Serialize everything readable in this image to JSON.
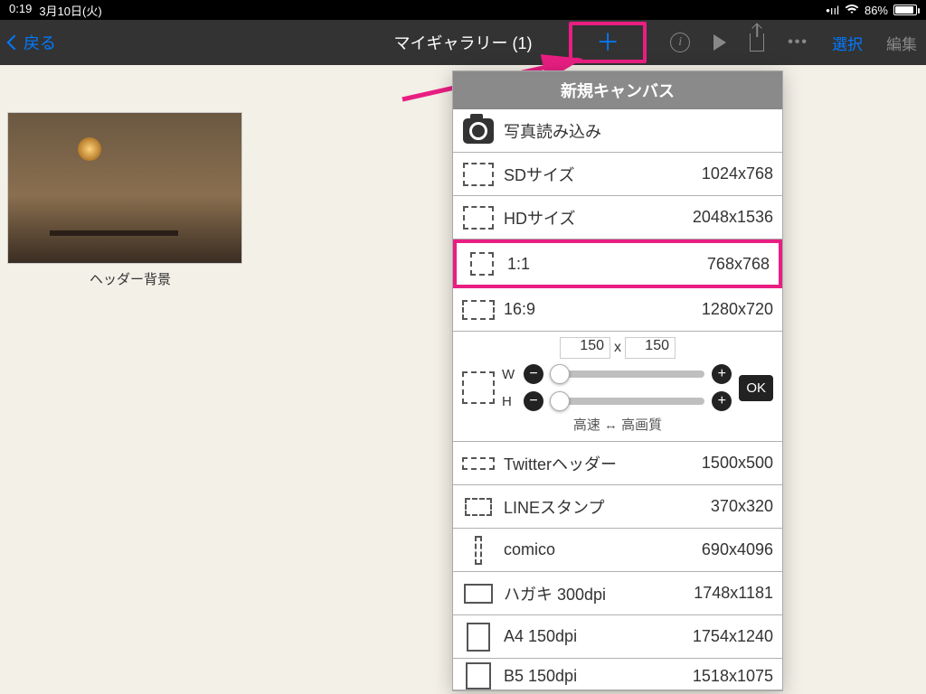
{
  "status": {
    "time": "0:19",
    "date": "3月10日(火)",
    "battery_pct": "86%"
  },
  "nav": {
    "back": "戻る",
    "title": "マイギャラリー (1)",
    "select": "選択",
    "edit": "編集",
    "plus": "＋"
  },
  "gallery": {
    "thumb_label": "ヘッダー背景"
  },
  "popover": {
    "title": "新規キャンバス",
    "import_photo": "写真読み込み",
    "custom": {
      "w": "150",
      "h": "150",
      "w_label": "W",
      "h_label": "H",
      "x": "x",
      "ok": "OK",
      "speed": "高速 ↔ 高画質"
    },
    "rows": [
      {
        "label": "SDサイズ",
        "dim": "1024x768"
      },
      {
        "label": "HDサイズ",
        "dim": "2048x1536"
      },
      {
        "label": "1:1",
        "dim": "768x768"
      },
      {
        "label": "16:9",
        "dim": "1280x720"
      },
      {
        "label": "Twitterヘッダー",
        "dim": "1500x500"
      },
      {
        "label": "LINEスタンプ",
        "dim": "370x320"
      },
      {
        "label": "comico",
        "dim": "690x4096"
      },
      {
        "label": "ハガキ 300dpi",
        "dim": "1748x1181"
      },
      {
        "label": "A4 150dpi",
        "dim": "1754x1240"
      },
      {
        "label": "B5 150dpi",
        "dim": "1518x1075"
      }
    ]
  }
}
